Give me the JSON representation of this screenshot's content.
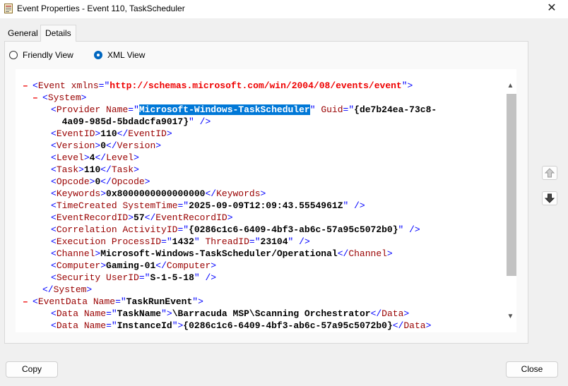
{
  "window": {
    "title": "Event Properties - Event 110, TaskScheduler",
    "close_glyph": "✕"
  },
  "tabs": [
    {
      "label": "General",
      "selected": false
    },
    {
      "label": "Details",
      "selected": true
    }
  ],
  "view_options": {
    "friendly_label": "Friendly View",
    "xml_label": "XML View",
    "selected": "XML View"
  },
  "xml": {
    "collapse_marker": "–",
    "lines": [
      {
        "marker": "–",
        "parts": [
          {
            "c": "b",
            "t": "<"
          },
          {
            "c": "r",
            "t": "Event"
          },
          {
            "c": "b",
            "t": " "
          },
          {
            "c": "r",
            "t": "xmlns"
          },
          {
            "c": "b",
            "t": "=\""
          },
          {
            "c": "ns",
            "t": "http://schemas.microsoft.com/win/2004/08/events/event"
          },
          {
            "c": "b",
            "t": "\">"
          }
        ]
      },
      {
        "marker": "–",
        "parts": [
          {
            "c": "b",
            "t": "<"
          },
          {
            "c": "r",
            "t": "System"
          },
          {
            "c": "b",
            "t": ">"
          }
        ]
      },
      {
        "parts": [
          {
            "c": "b",
            "t": "<"
          },
          {
            "c": "r",
            "t": "Provider"
          },
          {
            "c": "b",
            "t": " "
          },
          {
            "c": "r",
            "t": "Name"
          },
          {
            "c": "b",
            "t": "=\""
          },
          {
            "c": "v sel",
            "t": "Microsoft-Windows-TaskScheduler"
          },
          {
            "c": "b",
            "t": "\" "
          },
          {
            "c": "r",
            "t": "Guid"
          },
          {
            "c": "b",
            "t": "=\""
          },
          {
            "c": "v",
            "t": "{de7b24ea-73c8-"
          }
        ]
      },
      {
        "parts": [
          {
            "c": "v",
            "t": "  4a09-985d-5bdadcfa9017}"
          },
          {
            "c": "b",
            "t": "\" />"
          }
        ]
      },
      {
        "parts": [
          {
            "c": "b",
            "t": "<"
          },
          {
            "c": "r",
            "t": "EventID"
          },
          {
            "c": "b",
            "t": ">"
          },
          {
            "c": "v",
            "t": "110"
          },
          {
            "c": "b",
            "t": "</"
          },
          {
            "c": "r",
            "t": "EventID"
          },
          {
            "c": "b",
            "t": ">"
          }
        ]
      },
      {
        "parts": [
          {
            "c": "b",
            "t": "<"
          },
          {
            "c": "r",
            "t": "Version"
          },
          {
            "c": "b",
            "t": ">"
          },
          {
            "c": "v",
            "t": "0"
          },
          {
            "c": "b",
            "t": "</"
          },
          {
            "c": "r",
            "t": "Version"
          },
          {
            "c": "b",
            "t": ">"
          }
        ]
      },
      {
        "parts": [
          {
            "c": "b",
            "t": "<"
          },
          {
            "c": "r",
            "t": "Level"
          },
          {
            "c": "b",
            "t": ">"
          },
          {
            "c": "v",
            "t": "4"
          },
          {
            "c": "b",
            "t": "</"
          },
          {
            "c": "r",
            "t": "Level"
          },
          {
            "c": "b",
            "t": ">"
          }
        ]
      },
      {
        "parts": [
          {
            "c": "b",
            "t": "<"
          },
          {
            "c": "r",
            "t": "Task"
          },
          {
            "c": "b",
            "t": ">"
          },
          {
            "c": "v",
            "t": "110"
          },
          {
            "c": "b",
            "t": "</"
          },
          {
            "c": "r",
            "t": "Task"
          },
          {
            "c": "b",
            "t": ">"
          }
        ]
      },
      {
        "parts": [
          {
            "c": "b",
            "t": "<"
          },
          {
            "c": "r",
            "t": "Opcode"
          },
          {
            "c": "b",
            "t": ">"
          },
          {
            "c": "v",
            "t": "0"
          },
          {
            "c": "b",
            "t": "</"
          },
          {
            "c": "r",
            "t": "Opcode"
          },
          {
            "c": "b",
            "t": ">"
          }
        ]
      },
      {
        "parts": [
          {
            "c": "b",
            "t": "<"
          },
          {
            "c": "r",
            "t": "Keywords"
          },
          {
            "c": "b",
            "t": ">"
          },
          {
            "c": "v",
            "t": "0x8000000000000000"
          },
          {
            "c": "b",
            "t": "</"
          },
          {
            "c": "r",
            "t": "Keywords"
          },
          {
            "c": "b",
            "t": ">"
          }
        ]
      },
      {
        "parts": [
          {
            "c": "b",
            "t": "<"
          },
          {
            "c": "r",
            "t": "TimeCreated"
          },
          {
            "c": "b",
            "t": " "
          },
          {
            "c": "r",
            "t": "SystemTime"
          },
          {
            "c": "b",
            "t": "=\""
          },
          {
            "c": "v",
            "t": "2025-09-09T12:09:43.5554961Z"
          },
          {
            "c": "b",
            "t": "\" />"
          }
        ]
      },
      {
        "parts": [
          {
            "c": "b",
            "t": "<"
          },
          {
            "c": "r",
            "t": "EventRecordID"
          },
          {
            "c": "b",
            "t": ">"
          },
          {
            "c": "v",
            "t": "57"
          },
          {
            "c": "b",
            "t": "</"
          },
          {
            "c": "r",
            "t": "EventRecordID"
          },
          {
            "c": "b",
            "t": ">"
          }
        ]
      },
      {
        "parts": [
          {
            "c": "b",
            "t": "<"
          },
          {
            "c": "r",
            "t": "Correlation"
          },
          {
            "c": "b",
            "t": " "
          },
          {
            "c": "r",
            "t": "ActivityID"
          },
          {
            "c": "b",
            "t": "=\""
          },
          {
            "c": "v",
            "t": "{0286c1c6-6409-4bf3-ab6c-57a95c5072b0}"
          },
          {
            "c": "b",
            "t": "\" />"
          }
        ]
      },
      {
        "parts": [
          {
            "c": "b",
            "t": "<"
          },
          {
            "c": "r",
            "t": "Execution"
          },
          {
            "c": "b",
            "t": " "
          },
          {
            "c": "r",
            "t": "ProcessID"
          },
          {
            "c": "b",
            "t": "=\""
          },
          {
            "c": "v",
            "t": "1432"
          },
          {
            "c": "b",
            "t": "\" "
          },
          {
            "c": "r",
            "t": "ThreadID"
          },
          {
            "c": "b",
            "t": "=\""
          },
          {
            "c": "v",
            "t": "23104"
          },
          {
            "c": "b",
            "t": "\" />"
          }
        ]
      },
      {
        "parts": [
          {
            "c": "b",
            "t": "<"
          },
          {
            "c": "r",
            "t": "Channel"
          },
          {
            "c": "b",
            "t": ">"
          },
          {
            "c": "v",
            "t": "Microsoft-Windows-TaskScheduler/Operational"
          },
          {
            "c": "b",
            "t": "</"
          },
          {
            "c": "r",
            "t": "Channel"
          },
          {
            "c": "b",
            "t": ">"
          }
        ]
      },
      {
        "parts": [
          {
            "c": "b",
            "t": "<"
          },
          {
            "c": "r",
            "t": "Computer"
          },
          {
            "c": "b",
            "t": ">"
          },
          {
            "c": "v",
            "t": "Gaming-01"
          },
          {
            "c": "b",
            "t": "</"
          },
          {
            "c": "r",
            "t": "Computer"
          },
          {
            "c": "b",
            "t": ">"
          }
        ]
      },
      {
        "parts": [
          {
            "c": "b",
            "t": "<"
          },
          {
            "c": "r",
            "t": "Security"
          },
          {
            "c": "b",
            "t": " "
          },
          {
            "c": "r",
            "t": "UserID"
          },
          {
            "c": "b",
            "t": "=\""
          },
          {
            "c": "v",
            "t": "S-1-5-18"
          },
          {
            "c": "b",
            "t": "\" />"
          }
        ]
      },
      {
        "parts": [
          {
            "c": "b",
            "t": "</"
          },
          {
            "c": "r",
            "t": "System"
          },
          {
            "c": "b",
            "t": ">"
          }
        ]
      },
      {
        "marker": "–",
        "parts": [
          {
            "c": "b",
            "t": "<"
          },
          {
            "c": "r",
            "t": "EventData"
          },
          {
            "c": "b",
            "t": " "
          },
          {
            "c": "r",
            "t": "Name"
          },
          {
            "c": "b",
            "t": "=\""
          },
          {
            "c": "v",
            "t": "TaskRunEvent"
          },
          {
            "c": "b",
            "t": "\">"
          }
        ]
      },
      {
        "parts": [
          {
            "c": "b",
            "t": "<"
          },
          {
            "c": "r",
            "t": "Data"
          },
          {
            "c": "b",
            "t": " "
          },
          {
            "c": "r",
            "t": "Name"
          },
          {
            "c": "b",
            "t": "=\""
          },
          {
            "c": "v",
            "t": "TaskName"
          },
          {
            "c": "b",
            "t": "\">"
          },
          {
            "c": "v",
            "t": "\\Barracuda MSP\\Scanning Orchestrator"
          },
          {
            "c": "b",
            "t": "</"
          },
          {
            "c": "r",
            "t": "Data"
          },
          {
            "c": "b",
            "t": ">"
          }
        ]
      },
      {
        "parts": [
          {
            "c": "b",
            "t": "<"
          },
          {
            "c": "r",
            "t": "Data"
          },
          {
            "c": "b",
            "t": " "
          },
          {
            "c": "r",
            "t": "Name"
          },
          {
            "c": "b",
            "t": "=\""
          },
          {
            "c": "v",
            "t": "InstanceId"
          },
          {
            "c": "b",
            "t": "\">"
          },
          {
            "c": "v",
            "t": "{0286c1c6-6409-4bf3-ab6c-57a95c5072b0}"
          },
          {
            "c": "b",
            "t": "</"
          },
          {
            "c": "r",
            "t": "Data"
          },
          {
            "c": "b",
            "t": ">"
          }
        ]
      }
    ]
  },
  "scrollbar": {
    "up_glyph": "▲",
    "down_glyph": "▼"
  },
  "side_buttons": [
    {
      "name": "previous-event-button",
      "icon": "arrow-up-icon"
    },
    {
      "name": "next-event-button",
      "icon": "arrow-down-icon"
    }
  ],
  "buttons": {
    "copy": "Copy",
    "close": "Close"
  },
  "colors": {
    "selection": "#0078d7",
    "tag_blue": "#0000ff",
    "name_darkred": "#990000",
    "marker_red": "#ee0000"
  }
}
